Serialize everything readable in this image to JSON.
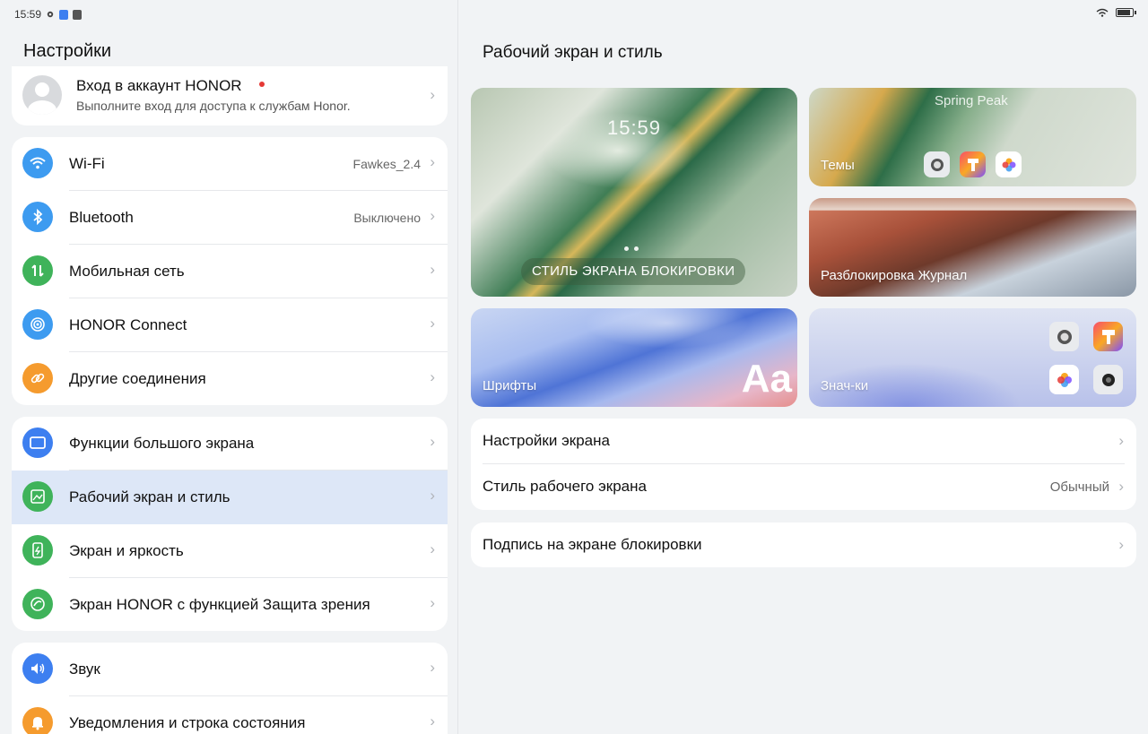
{
  "status_bar": {
    "time": "15:59"
  },
  "left_panel": {
    "title": "Настройки",
    "account": {
      "title": "Вход в аккаунт HONOR",
      "subtitle": "Выполните вход для доступа к службам Honor."
    },
    "groups": [
      [
        {
          "label": "Wi-Fi",
          "value": "Fawkes_2.4",
          "icon": "wifi-icon",
          "color": "#3d9bf0"
        },
        {
          "label": "Bluetooth",
          "value": "Выключено",
          "icon": "bluetooth-icon",
          "color": "#3d9bf0"
        },
        {
          "label": "Мобильная сеть",
          "value": "",
          "icon": "mobile-network-icon",
          "color": "#3fb35a"
        },
        {
          "label": "HONOR Connect",
          "value": "",
          "icon": "honor-connect-icon",
          "color": "#3d9bf0"
        },
        {
          "label": "Другие соединения",
          "value": "",
          "icon": "link-icon",
          "color": "#f59b2e"
        }
      ],
      [
        {
          "label": "Функции большого экрана",
          "value": "",
          "icon": "tablet-icon",
          "color": "#3d7ff0"
        },
        {
          "label": "Рабочий экран и стиль",
          "value": "",
          "icon": "image-icon",
          "color": "#3fb35a"
        },
        {
          "label": "Экран и яркость",
          "value": "",
          "icon": "brightness-icon",
          "color": "#3fb35a"
        },
        {
          "label": "Экран HONOR с функцией Защита зрения",
          "value": "",
          "icon": "eye-comfort-icon",
          "color": "#3fb35a"
        }
      ],
      [
        {
          "label": "Звук",
          "value": "",
          "icon": "sound-icon",
          "color": "#3d7ff0"
        },
        {
          "label": "Уведомления и строка состояния",
          "value": "",
          "icon": "bell-icon",
          "color": "#f59b2e"
        }
      ]
    ]
  },
  "right_panel": {
    "title": "Рабочий экран и стиль",
    "tiles": {
      "lock_time": "15:59",
      "lock_label": "СТИЛЬ ЭКРАНА БЛОКИРОВКИ",
      "themes_name": "Spring Peak",
      "themes_label": "Темы",
      "unlock_label": "Разблокировка Журнал",
      "fonts_label": "Шрифты",
      "fonts_sample": "Aa",
      "icons_label": "Знач-ки"
    },
    "settings": [
      {
        "label": "Настройки экрана",
        "value": ""
      },
      {
        "label": "Стиль рабочего экрана",
        "value": "Обычный"
      }
    ],
    "lockscreen_signature": "Подпись на экране блокировки"
  },
  "selected_item": "Рабочий экран и стиль",
  "accent_color": "#dde7f7"
}
